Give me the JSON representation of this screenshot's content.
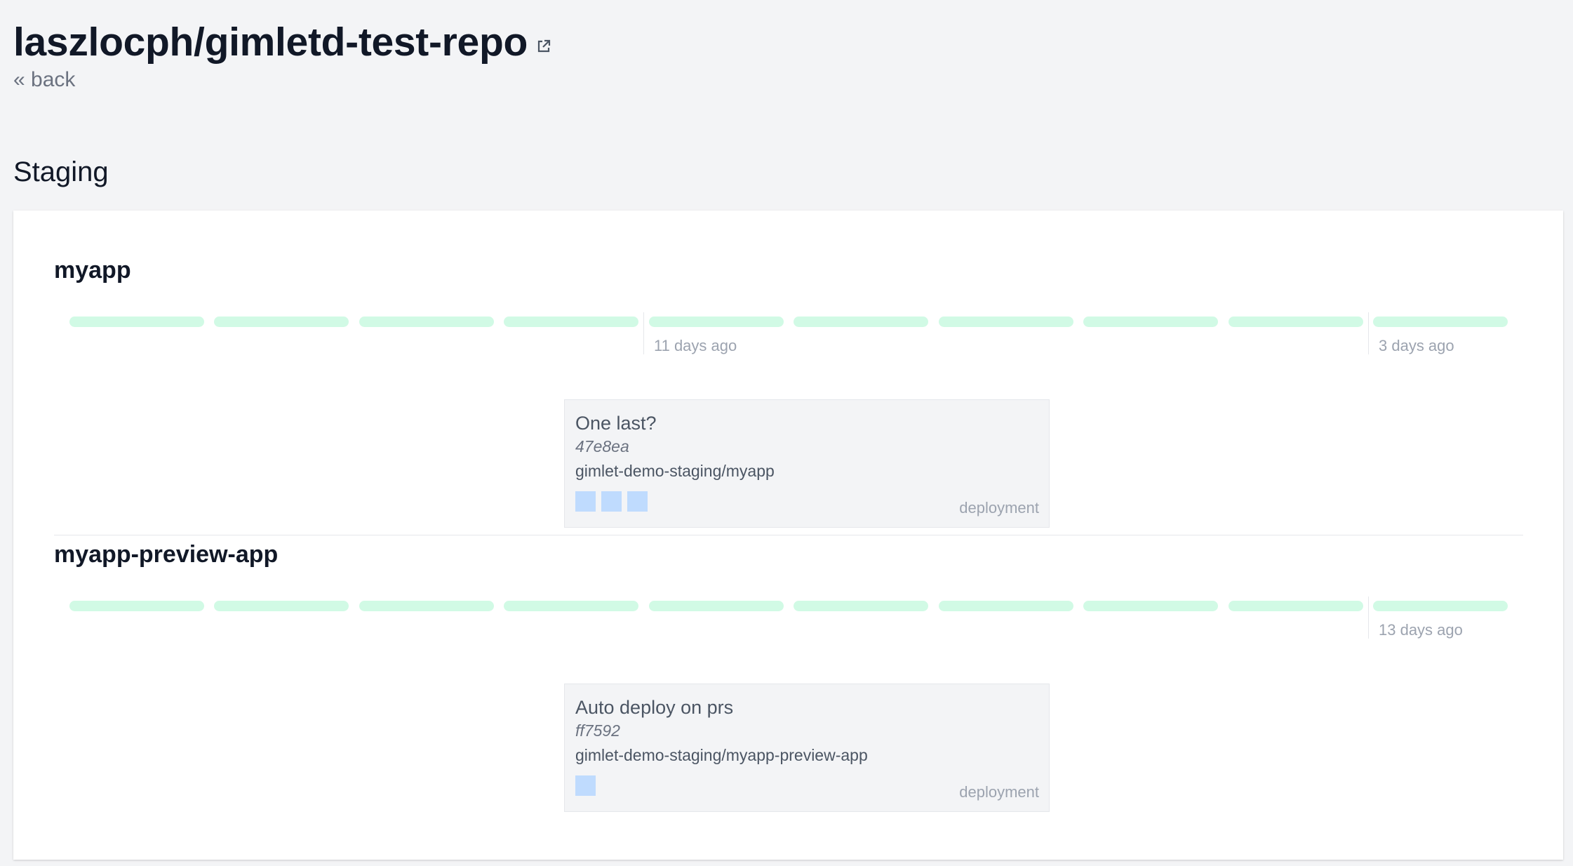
{
  "header": {
    "repo_title": "laszlocph/gimletd-test-repo",
    "external_icon": "external-link-icon",
    "back_label": "« back"
  },
  "environment": {
    "name": "Staging"
  },
  "stacks": [
    {
      "name": "myapp",
      "timeline_segments": 10,
      "timeline_labels": [
        "11 days ago",
        "3 days ago"
      ],
      "release": {
        "title": "One last?",
        "sha": "47e8ea",
        "path": "gimlet-demo-staging/myapp",
        "indicator_count": 3,
        "type": "deployment"
      }
    },
    {
      "name": "myapp-preview-app",
      "timeline_segments": 10,
      "timeline_labels": [
        "13 days ago"
      ],
      "release": {
        "title": "Auto deploy on prs",
        "sha": "ff7592",
        "path": "gimlet-demo-staging/myapp-preview-app",
        "indicator_count": 1,
        "type": "deployment"
      }
    }
  ],
  "colors": {
    "segment": "#d1fae5",
    "indicator": "#bfdbfe",
    "muted_text": "#9ca3af"
  }
}
